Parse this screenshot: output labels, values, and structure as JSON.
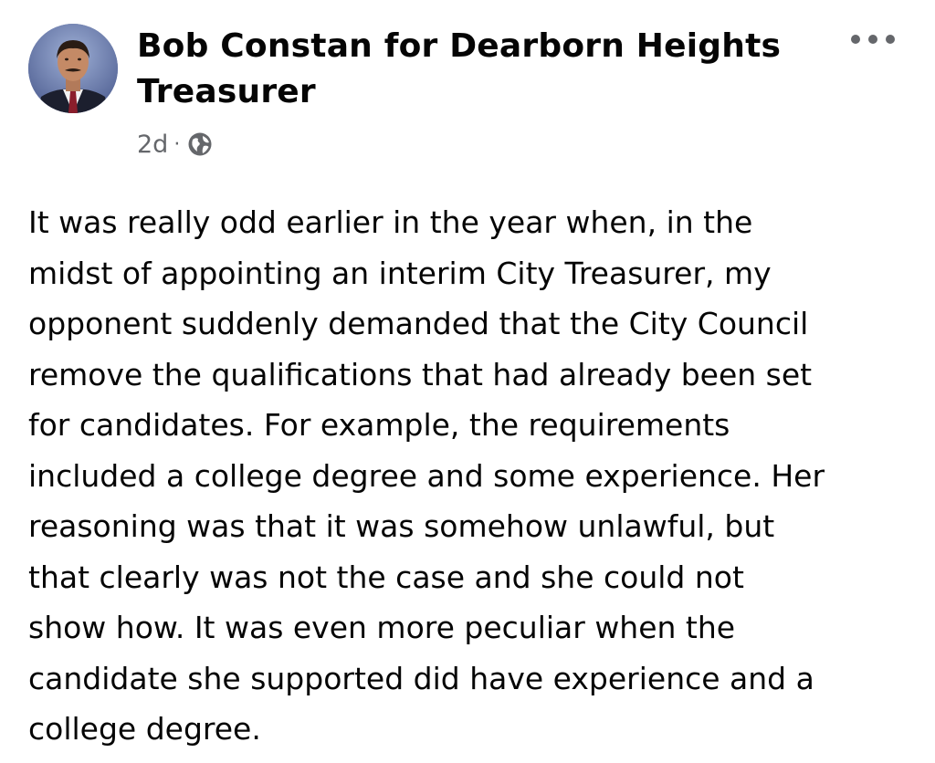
{
  "post": {
    "author_name": "Bob Constan for Dearborn Heights Treasurer",
    "timestamp": "2d",
    "separator": "·",
    "audience_icon": "globe-icon",
    "more_icon": "more-options-icon",
    "body_lines": [
      "It was really odd earlier in the year when, in the",
      "midst of appointing an interim City Treasurer, my",
      "opponent suddenly demanded that the City Council",
      "remove the qualifications that had already been set",
      "for candidates. For example, the requirements",
      "included a college degree and some experience. Her",
      "reasoning was that it was somehow unlawful, but",
      "that clearly was not the case and she could not",
      "show how. It was even more peculiar when the",
      "candidate she supported did have experience and a",
      "college degree."
    ]
  },
  "colors": {
    "text_primary": "#050505",
    "text_secondary": "#65676b",
    "background": "#ffffff"
  }
}
